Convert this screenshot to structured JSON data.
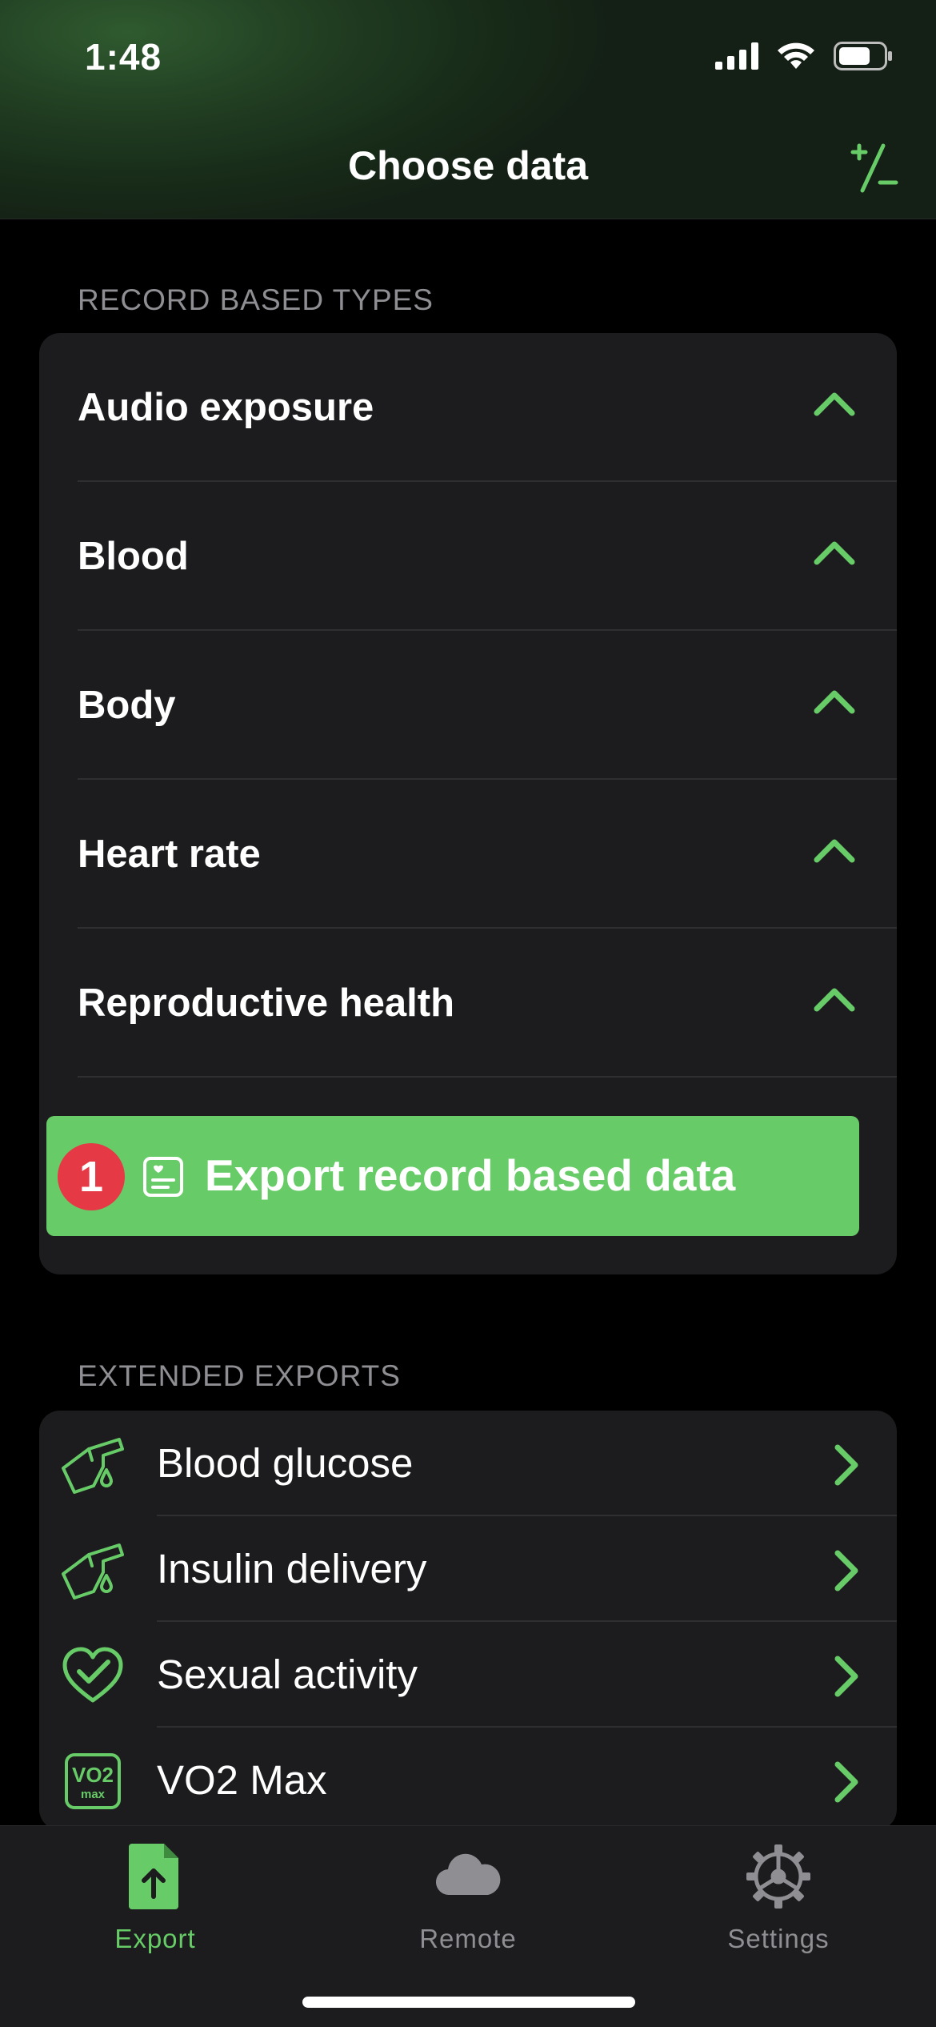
{
  "status_bar": {
    "time": "1:48"
  },
  "nav": {
    "title": "Choose data",
    "action_icon": "plus-minus-icon"
  },
  "colors": {
    "accent": "#67cc67",
    "badge": "#e63946",
    "card": "#1c1c1e",
    "secondary_text": "#8e8e93"
  },
  "record_based": {
    "header": "RECORD BASED TYPES",
    "items": [
      {
        "label": "Audio exposure"
      },
      {
        "label": "Blood"
      },
      {
        "label": "Body"
      },
      {
        "label": "Heart rate"
      },
      {
        "label": "Reproductive health"
      }
    ],
    "export_button": {
      "badge": "1",
      "label": "Export record based data"
    }
  },
  "extended": {
    "header": "EXTENDED EXPORTS",
    "items": [
      {
        "label": "Blood glucose",
        "icon": "finger-drop-icon"
      },
      {
        "label": "Insulin delivery",
        "icon": "finger-drop-icon"
      },
      {
        "label": "Sexual activity",
        "icon": "heart-check-icon"
      },
      {
        "label": "VO2 Max",
        "icon": "vo2-max-icon",
        "icon_text": {
          "top": "VO2",
          "bottom": "max"
        }
      }
    ]
  },
  "tabs": [
    {
      "label": "Export",
      "icon": "export-document-icon",
      "active": true
    },
    {
      "label": "Remote",
      "icon": "cloud-icon",
      "active": false
    },
    {
      "label": "Settings",
      "icon": "gear-icon",
      "active": false
    }
  ]
}
